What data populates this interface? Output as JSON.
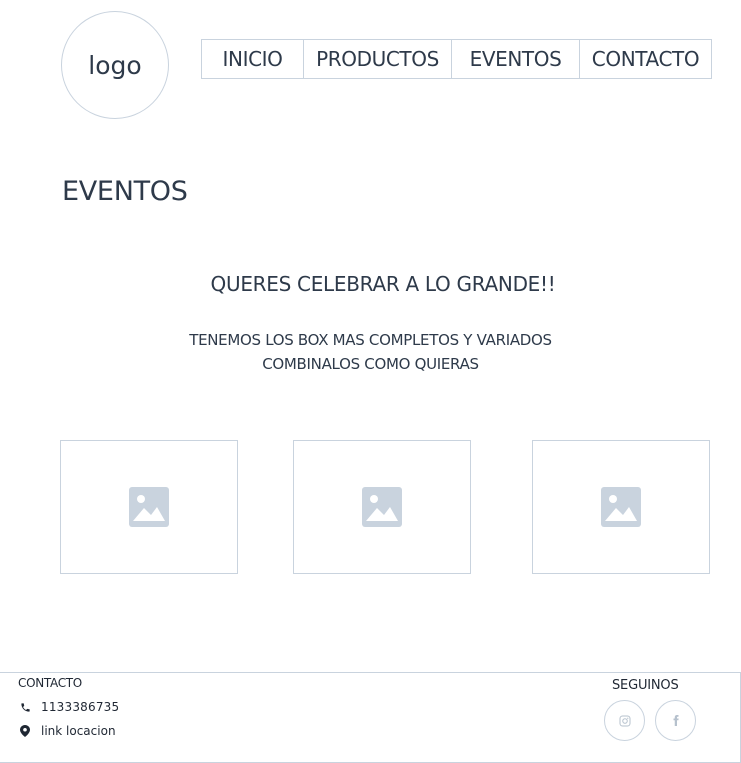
{
  "header": {
    "logo_text": "logo",
    "nav": [
      {
        "label": "INICIO"
      },
      {
        "label": "PRODUCTOS"
      },
      {
        "label": "EVENTOS"
      },
      {
        "label": "CONTACTO"
      }
    ]
  },
  "main": {
    "page_title": "EVENTOS",
    "headline": "QUERES CELEBRAR A LO GRANDE!!",
    "subline_1": "TENEMOS LOS BOX MAS COMPLETOS Y VARIADOS",
    "subline_2": "COMBINALOS COMO QUIERAS",
    "images": [
      {
        "icon": "image-placeholder-icon"
      },
      {
        "icon": "image-placeholder-icon"
      },
      {
        "icon": "image-placeholder-icon"
      }
    ]
  },
  "footer": {
    "contact_heading": "CONTACTO",
    "phone": "1133386735",
    "phone_icon": "phone-icon",
    "location": "link locacion",
    "location_icon": "location-pin-icon",
    "social_heading": "SEGUINOS",
    "social": [
      {
        "icon": "instagram-icon"
      },
      {
        "icon": "facebook-icon"
      }
    ]
  },
  "colors": {
    "text": "#2e3a4a",
    "border": "#c9d3de",
    "placeholder_fill": "#c9d3de"
  }
}
